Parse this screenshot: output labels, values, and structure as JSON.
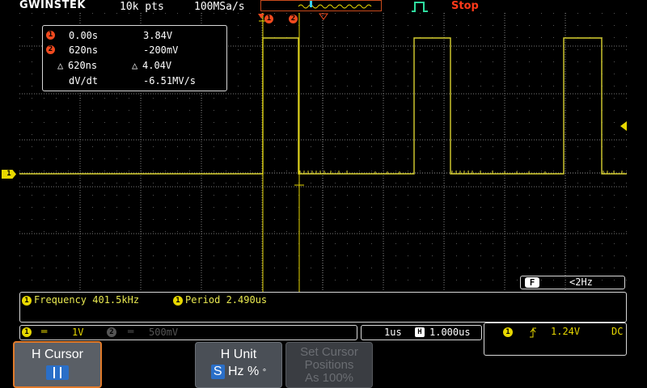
{
  "header": {
    "brand": "GWINSTEK",
    "record_length": "10k pts",
    "sample_rate": "100MSa/s",
    "run_state": "Stop"
  },
  "cursor_readout": {
    "c1_marker": "1",
    "c2_marker": "2",
    "c1_time": "0.00s",
    "c1_volt": "3.84V",
    "c2_time": "620ns",
    "c2_volt": "-200mV",
    "delta_time_symbol": "△",
    "delta_time": "620ns",
    "delta_volt_symbol": "△",
    "delta_volt": "4.04V",
    "slope_label": "dV/dt",
    "slope_value": "-6.51MV/s"
  },
  "channel_marker": "1",
  "filter": {
    "badge": "F",
    "value": "<2Hz"
  },
  "measurements": [
    {
      "channel": "1",
      "label": "Frequency 401.5kHz"
    },
    {
      "channel": "1",
      "label": "Period 2.490us"
    }
  ],
  "status": {
    "ch1_id": "1",
    "ch1_scale": "1V",
    "ch2_id": "2",
    "ch2_scale": "500mV",
    "timebase": "1us",
    "h_badge": "H",
    "h_position": "1.000us",
    "trig_source": "1",
    "trig_level": "1.24V",
    "trig_coupling": "DC"
  },
  "softkeys": {
    "hcursor_label": "H Cursor",
    "hunit_label": "H Unit",
    "hunit_s": "S",
    "hunit_hz": "Hz",
    "hunit_pct": "%",
    "hunit_deg": "°",
    "setcursor_line1": "Set Cursor",
    "setcursor_line2": "Positions",
    "setcursor_line3": "As 100%"
  },
  "colors": {
    "ch1": "#e8d800",
    "cursor": "#f04a1f",
    "accent": "#e07a2a"
  }
}
